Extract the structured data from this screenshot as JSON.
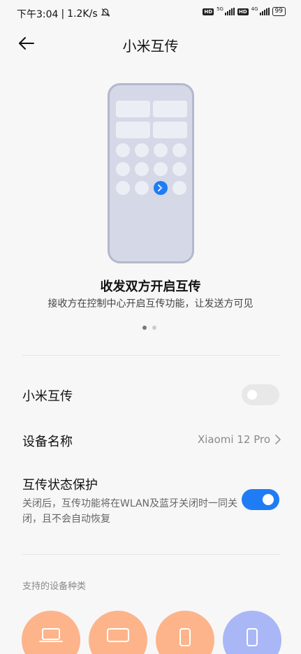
{
  "status_bar": {
    "time": "下午3:04",
    "speed": "1.2K/s",
    "network1": "5G",
    "network2": "4G",
    "hd_label": "HD",
    "battery": "99"
  },
  "header": {
    "title": "小米互传"
  },
  "hero": {
    "title": "收发双方开启互传",
    "subtitle": "接收方在控制中心开启互传功能，让发送方可见",
    "page_index": 1,
    "page_count": 2
  },
  "settings": {
    "mi_share": {
      "label": "小米互传",
      "enabled": false
    },
    "device_name": {
      "label": "设备名称",
      "value": "Xiaomi 12 Pro"
    },
    "status_protect": {
      "label": "互传状态保护",
      "description": "关闭后，互传功能将在WLAN及蓝牙关闭时一同关闭，且不会自动恢复",
      "enabled": true
    }
  },
  "supported": {
    "label": "支持的设备种类",
    "devices": [
      {
        "icon": "laptop-icon",
        "color": "#fdb48a"
      },
      {
        "icon": "tablet-icon",
        "color": "#fdb48a"
      },
      {
        "icon": "phone-icon",
        "color": "#fdb48a"
      },
      {
        "icon": "phone-icon",
        "color": "#a9b7f6"
      }
    ]
  },
  "colors": {
    "accent": "#1f7cf5",
    "peach": "#fdb48a",
    "lavender": "#a9b7f6"
  }
}
